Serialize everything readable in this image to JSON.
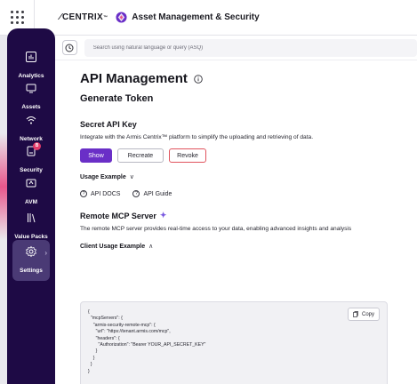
{
  "header": {
    "logo_mark": "⁄",
    "logo_text": "CENTRIX",
    "logo_tm": "™",
    "app_title": "Asset Management & Security"
  },
  "sidebar": {
    "items": [
      {
        "label": "Analytics",
        "icon": "analytics-icon"
      },
      {
        "label": "Assets",
        "icon": "assets-icon"
      },
      {
        "label": "Network",
        "icon": "network-icon"
      },
      {
        "label": "Security",
        "icon": "security-icon",
        "badge": "B"
      },
      {
        "label": "AVM",
        "icon": "avm-icon"
      },
      {
        "label": "Value Packs",
        "icon": "value-packs-icon"
      },
      {
        "label": "Settings",
        "icon": "settings-icon",
        "active": true,
        "chevron": "›"
      }
    ]
  },
  "search": {
    "placeholder": "Search using natural language or query (ASQ)"
  },
  "page": {
    "title": "API Management",
    "subtitle": "Generate Token"
  },
  "secret_key": {
    "title": "Secret API Key",
    "description": "Integrate with the Armis Centrix™ platform to simplify the uploading and retrieving of data.",
    "buttons": {
      "show": "Show",
      "recreate": "Recreate",
      "revoke": "Revoke"
    }
  },
  "usage": {
    "label": "Usage Example",
    "caret": "∨",
    "links": {
      "api_docs": "API DOCS",
      "api_guide": "API Guide"
    }
  },
  "mcp": {
    "title": "Remote MCP Server",
    "sparkle": "✦",
    "description": "The remote MCP server provides real-time access to your data, enabling advanced insights and analysis",
    "client_label": "Client Usage Example",
    "client_caret": "∧",
    "copy_label": "Copy",
    "code": "{\n  \"mcpServers\": {\n    \"armis-security-remote-mcp\": {\n      \"url\": \"https://tenant.armis.com/mcp\",\n      \"headers\": {\n        \"Authorization\": \"Bearer YOUR_API_SECRET_KEY\"\n      }\n    }\n  }\n}"
  },
  "colors": {
    "sidebar": "#1e0a45",
    "primary": "#6a2fc7",
    "danger": "#e0535d"
  }
}
